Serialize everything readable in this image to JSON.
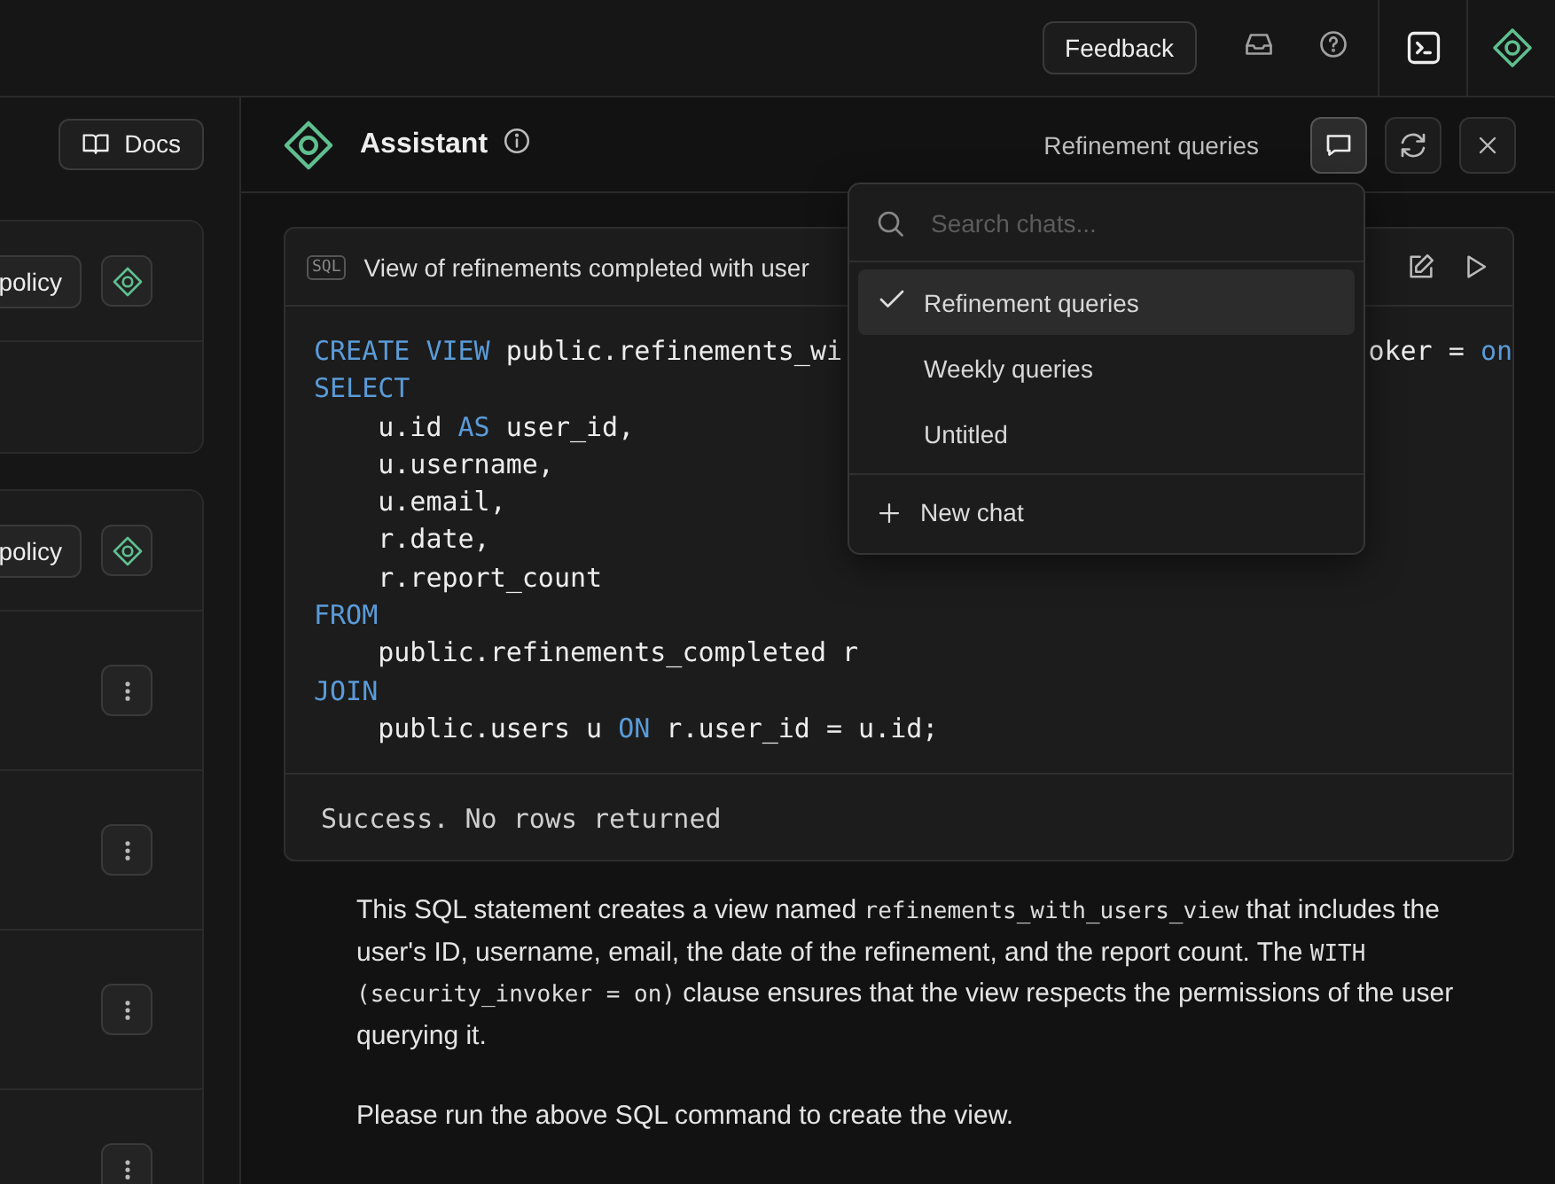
{
  "top_bar": {
    "feedback": "Feedback"
  },
  "left_panel": {
    "docs": "Docs",
    "cards": [
      {
        "policy_button": "policy",
        "rows": [
          {
            "kind": "empty"
          }
        ]
      },
      {
        "policy_button": "policy",
        "rows": [
          {
            "kind": "menu"
          },
          {
            "kind": "menu"
          },
          {
            "kind": "menu"
          },
          {
            "kind": "menu"
          }
        ]
      }
    ]
  },
  "assistant": {
    "title": "Assistant",
    "chat_name": "Refinement queries",
    "chat_button_active": true,
    "code_block": {
      "badge": "SQL",
      "title": "View of refinements completed with user",
      "lines": [
        [
          [
            {
              "kind": "keyword",
              "t": "CREATE VIEW"
            },
            {
              "kind": "plain",
              "t": " public.refinements_wi"
            }
          ],
          [
            {
              "kind": "plain",
              "t": "oker = "
            },
            {
              "kind": "keyword",
              "t": "on"
            }
          ]
        ],
        [
          [
            {
              "kind": "keyword",
              "t": "SELECT"
            }
          ]
        ],
        [
          [
            {
              "kind": "plain",
              "t": "    u.id "
            },
            {
              "kind": "keyword",
              "t": "AS"
            },
            {
              "kind": "plain",
              "t": " user_id,"
            }
          ]
        ],
        [
          [
            {
              "kind": "plain",
              "t": "    u.username,"
            }
          ]
        ],
        [
          [
            {
              "kind": "plain",
              "t": "    u.email,"
            }
          ]
        ],
        [
          [
            {
              "kind": "plain",
              "t": "    r.date,"
            }
          ]
        ],
        [
          [
            {
              "kind": "plain",
              "t": "    r.report_count"
            }
          ]
        ],
        [
          [
            {
              "kind": "keyword",
              "t": "FROM"
            }
          ]
        ],
        [
          [
            {
              "kind": "plain",
              "t": "    public.refinements_completed r"
            }
          ]
        ],
        [
          [
            {
              "kind": "keyword",
              "t": "JOIN"
            }
          ]
        ],
        [
          [
            {
              "kind": "plain",
              "t": "    public.users u "
            },
            {
              "kind": "keyword",
              "t": "ON"
            },
            {
              "kind": "plain",
              "t": " r.user_id = u.id;"
            }
          ]
        ]
      ],
      "result": "Success. No rows returned"
    },
    "paragraphs": [
      [
        {
          "kind": "text",
          "text": "This SQL statement creates a view named "
        },
        {
          "kind": "code",
          "text": "refinements_with_users_view"
        },
        {
          "kind": "text",
          "text": " that includes the user's ID, username, email, the date of the refinement, and the report count. The "
        },
        {
          "kind": "code",
          "text": "WITH (security_invoker = on)"
        },
        {
          "kind": "text",
          "text": " clause ensures that the view respects the permissions of the user querying it."
        }
      ],
      [
        {
          "kind": "text",
          "text": "Please run the above SQL command to create the view."
        }
      ]
    ],
    "chat_menu": {
      "search": {
        "placeholder": "Search chats..."
      },
      "items": [
        {
          "label": "Refinement queries",
          "selected": true
        },
        {
          "label": "Weekly queries",
          "selected": false
        },
        {
          "label": "Untitled",
          "selected": false
        }
      ],
      "new_chat": "New chat"
    }
  }
}
